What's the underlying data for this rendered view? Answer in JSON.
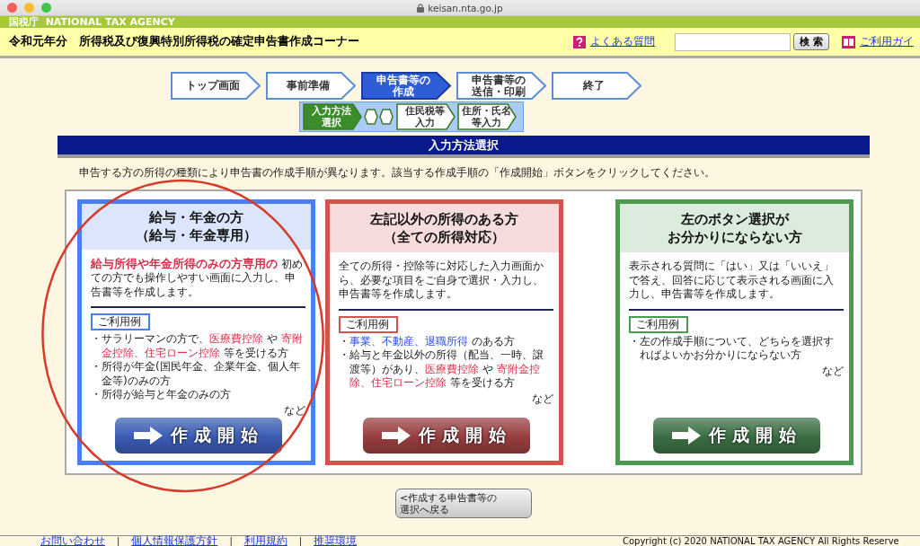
{
  "browser": {
    "url": "keisan.nta.go.jp"
  },
  "header": {
    "agency": "国税庁  NATIONAL TAX AGENCY",
    "title": "令和元年分　所得税及び復興特別所得税の確定申告書作成コーナー",
    "help_link": "よくある質問",
    "search_button": "検 索",
    "guide_link": "ご利用ガイ"
  },
  "steps": [
    {
      "label": [
        "トップ画面"
      ],
      "selected": false
    },
    {
      "label": [
        "事前準備"
      ],
      "selected": false
    },
    {
      "label": [
        "申告書等の",
        "作成"
      ],
      "selected": true
    },
    {
      "label": [
        "申告書等の",
        "送信・印刷"
      ],
      "selected": false
    },
    {
      "label": [
        "終了"
      ],
      "selected": false
    }
  ],
  "substeps": [
    {
      "label": [
        "入力方法",
        "選択"
      ],
      "selected": true
    },
    {
      "label": [
        "住民税等",
        "入力"
      ],
      "selected": false
    },
    {
      "label": [
        "住所・氏名",
        "等入力"
      ],
      "selected": false
    }
  ],
  "section_title": "入力方法選択",
  "instruction": "申告する方の所得の種類により申告書の作成手順が異なります。該当する作成手順の「作成開始」ボタンをクリックしてください。",
  "cards": [
    {
      "color": "#4a7ff0",
      "title": [
        "給与・年金の方",
        "（給与・年金専用）"
      ],
      "description": "**給与所得や年金所得のみの方専用の** 初めての方でも操作しやすい画面に入力し、申告書等を作成します。",
      "examples_label": "ご利用例",
      "examples": [
        "・サラリーマンの方で、**医療費控除** や **寄附金控除、住宅ローン控除** 等を受ける方",
        "・所得が年金(国民年金、企業年金、個人年金等)のみの方",
        "・所得が給与と年金のみの方"
      ],
      "etc": "など",
      "button": "作成開始"
    },
    {
      "color": "#d0554c",
      "title": [
        "左記以外の所得のある方",
        "（全ての所得対応）"
      ],
      "description": "全ての所得・控除等に対応した入力画面から、必要な項目をご自身で選択・入力し、申告書等を作成します。",
      "examples_label": "ご利用例",
      "examples": [
        "・*事業、不動産、退職所得* のある方",
        "・給与と年金以外の所得（配当、一時、譲渡等）があり、**医療費控除** や **寄附金控除、住宅ローン控除** 等を受ける方"
      ],
      "etc": "など",
      "button": "作成開始"
    },
    {
      "color": "#4a9a50",
      "title": [
        "左のボタン選択が",
        "お分かりにならない方"
      ],
      "description": "表示される質問に「はい」又は「いいえ」で答え、回答に応じて表示される画面に入力し、申告書等を作成します。",
      "examples_label": "ご利用例",
      "examples": [
        "・左の作成手順について、どちらを選択すればよいかお分かりにならない方"
      ],
      "etc": "など",
      "button": "作成開始"
    }
  ],
  "back_button": [
    "<作成する申告書等の",
    "選択へ戻る"
  ],
  "footer": {
    "links": [
      "お問い合わせ",
      "個人情報保護方針",
      "利用規約",
      "推奨環境"
    ],
    "separator": "|",
    "copyright": "Copyright (c) 2020 NATIONAL TAX AGENCY All Rights Reserve"
  },
  "annotation": {
    "kind": "circle",
    "color": "#d63a2a"
  }
}
